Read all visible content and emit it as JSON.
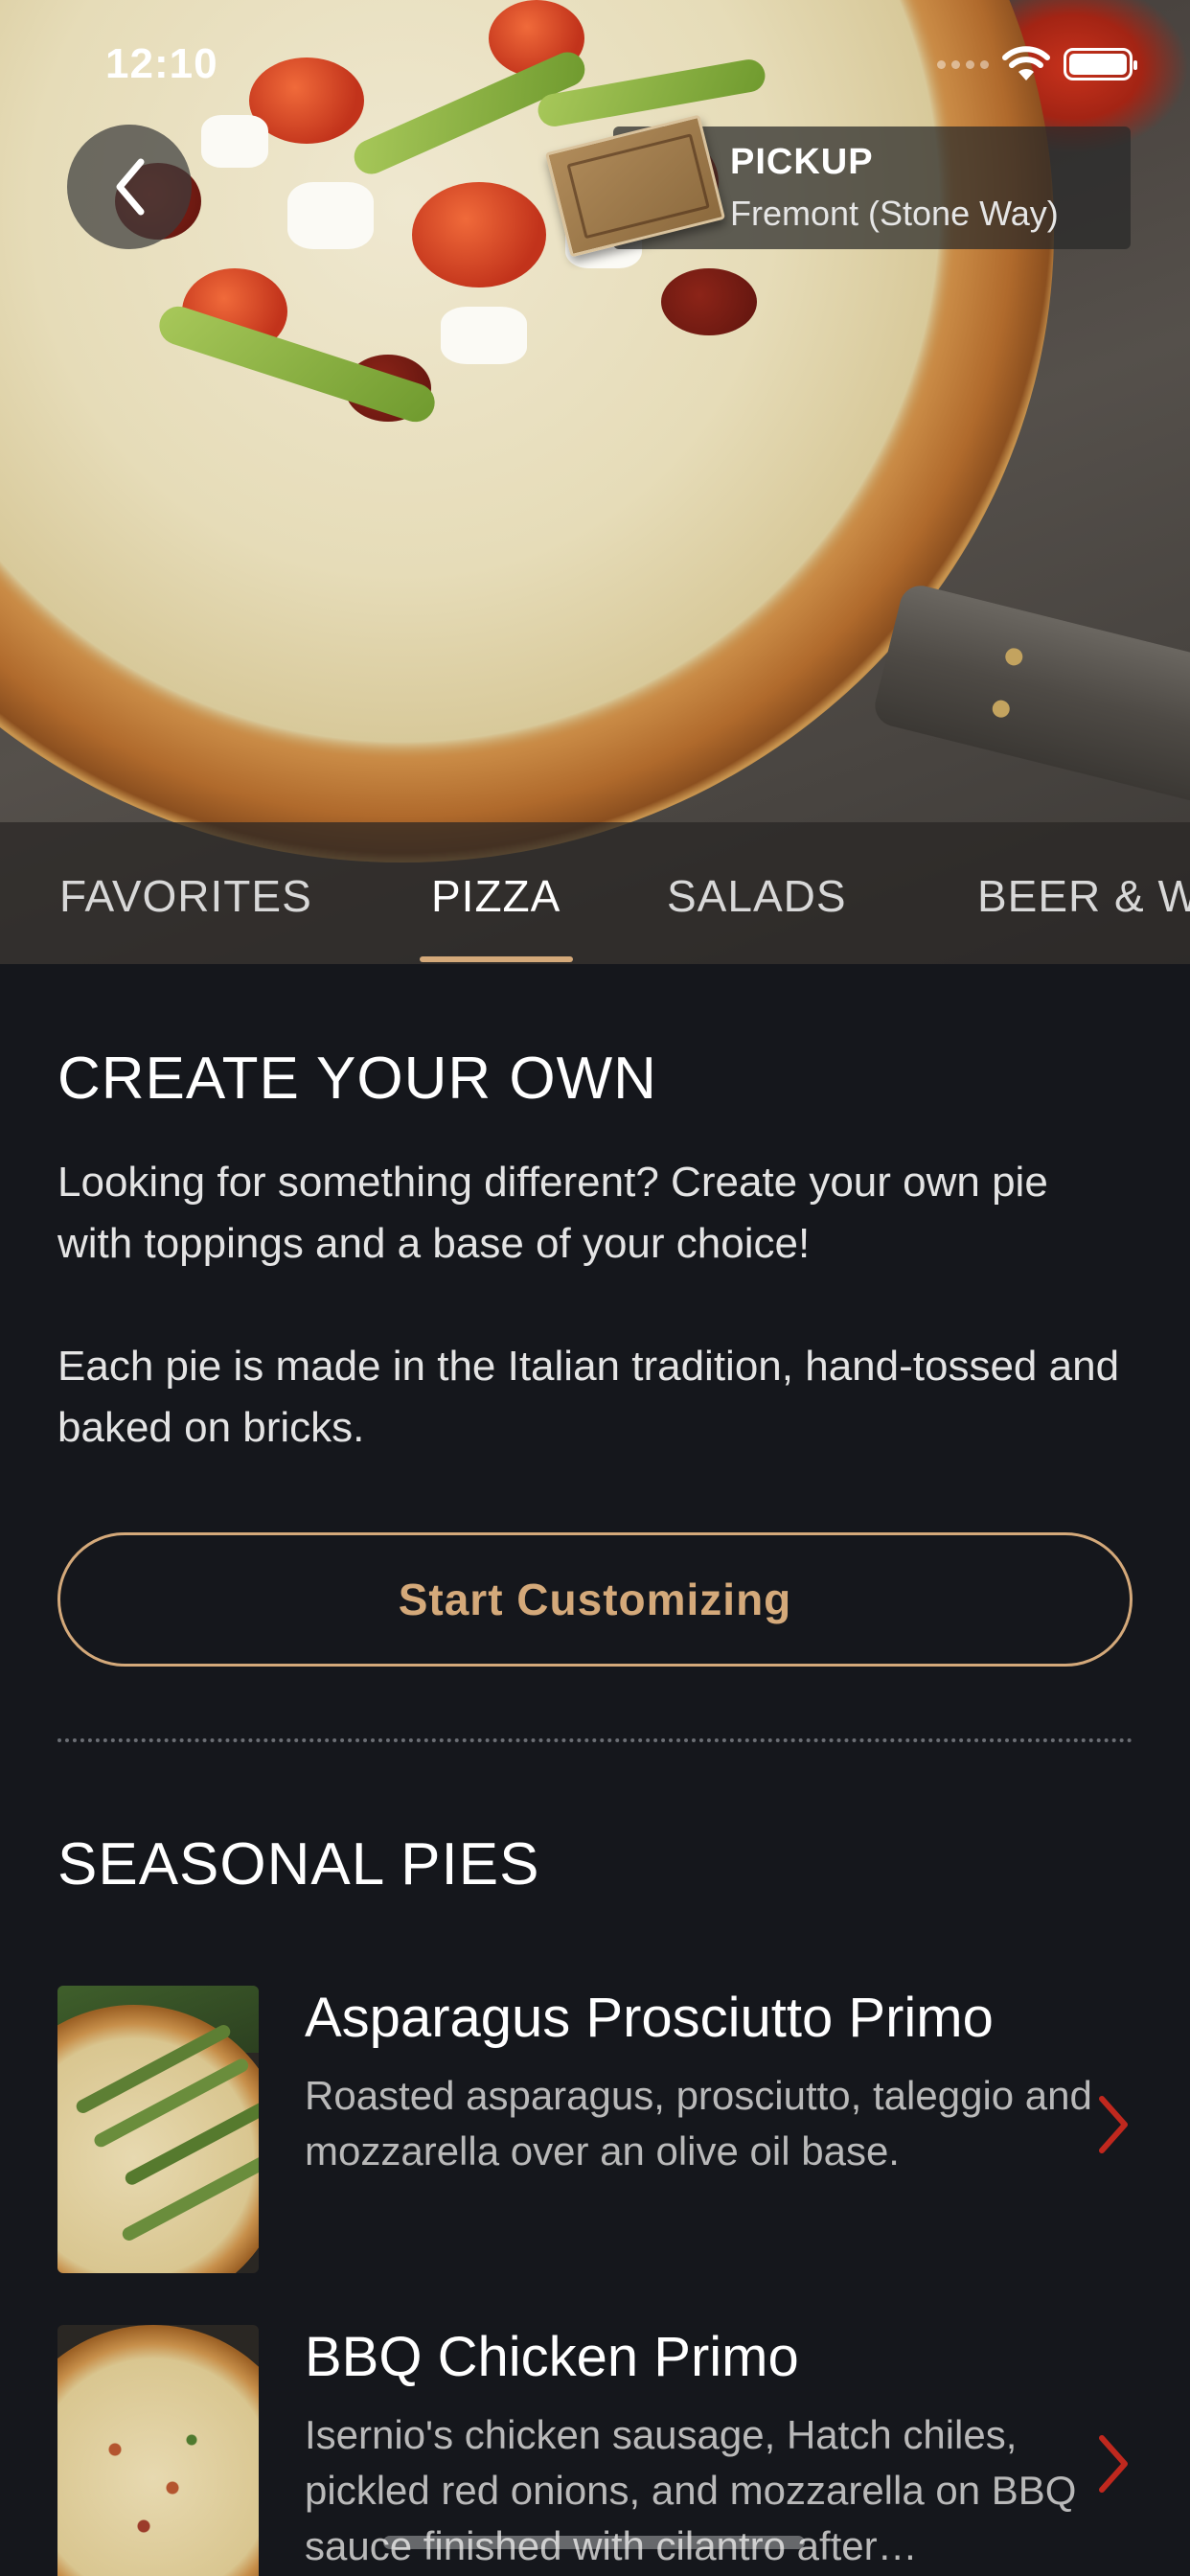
{
  "status_bar": {
    "time": "12:10"
  },
  "header": {
    "pickup_label": "PICKUP",
    "pickup_location": "Fremont (Stone Way)"
  },
  "tabs": [
    {
      "label": "FAVORITES",
      "active": false
    },
    {
      "label": "PIZZA",
      "active": true
    },
    {
      "label": "SALADS",
      "active": false
    },
    {
      "label": "BEER & W",
      "active": false
    }
  ],
  "create_your_own": {
    "title": "CREATE YOUR OWN",
    "paragraph1": "Looking for something different? Create your own pie with toppings and a base of your choice!",
    "paragraph2": "Each pie is made in the Italian tradition, hand-tossed and baked on bricks.",
    "button_label": "Start Customizing"
  },
  "seasonal_pies": {
    "title": "SEASONAL PIES",
    "items": [
      {
        "name": "Asparagus Prosciutto Primo",
        "description": "Roasted asparagus, prosciutto, taleggio and mozzarella over an olive oil base."
      },
      {
        "name": "BBQ Chicken Primo",
        "description": "Isernio's chicken sausage, Hatch chiles, pickled red onions, and mozzarella on BBQ sauce finished with cilantro after…"
      }
    ]
  },
  "colors": {
    "background": "#15171c",
    "accent": "#d4a97a",
    "chevron": "#c0281e"
  },
  "icons": {
    "back": "chevron-left-icon",
    "wifi": "wifi-icon",
    "battery": "battery-icon",
    "row_chevron": "chevron-right-icon"
  }
}
